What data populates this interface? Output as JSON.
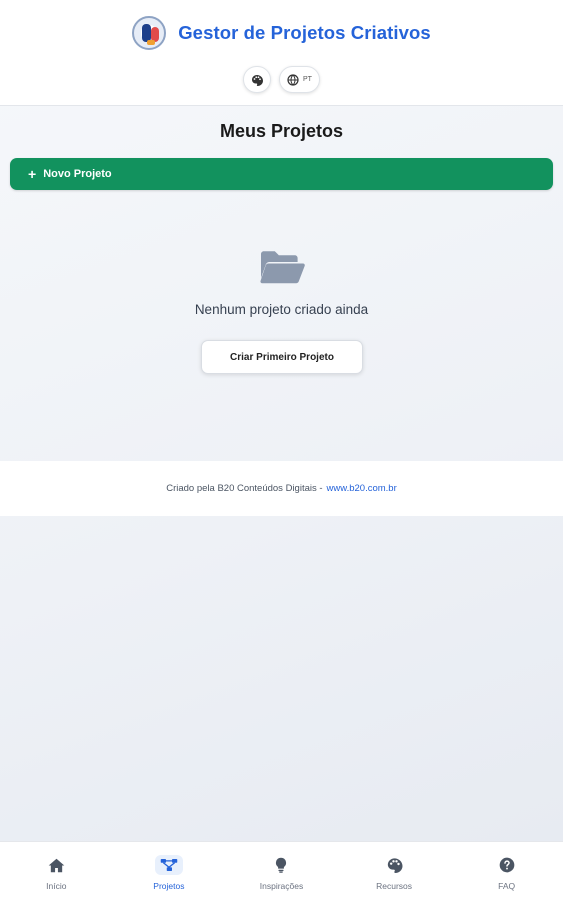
{
  "header": {
    "title": "Gestor de Projetos Criativos",
    "language": "PT"
  },
  "main": {
    "title": "Meus Projetos",
    "new_project_label": "Novo Projeto",
    "empty_message": "Nenhum projeto criado ainda",
    "create_first_label": "Criar Primeiro Projeto"
  },
  "footer": {
    "credit": "Criado pela B20 Conteúdos Digitais -",
    "link": "www.b20.com.br"
  },
  "nav": {
    "items": [
      {
        "label": "Início",
        "icon": "home-icon"
      },
      {
        "label": "Projetos",
        "icon": "projects-icon"
      },
      {
        "label": "Inspirações",
        "icon": "lightbulb-icon"
      },
      {
        "label": "Recursos",
        "icon": "palette-icon"
      },
      {
        "label": "FAQ",
        "icon": "question-icon"
      }
    ],
    "active": "Projetos"
  },
  "colors": {
    "accent": "#2563d9",
    "primary_button": "#12925e",
    "background": "#eef1f6"
  }
}
